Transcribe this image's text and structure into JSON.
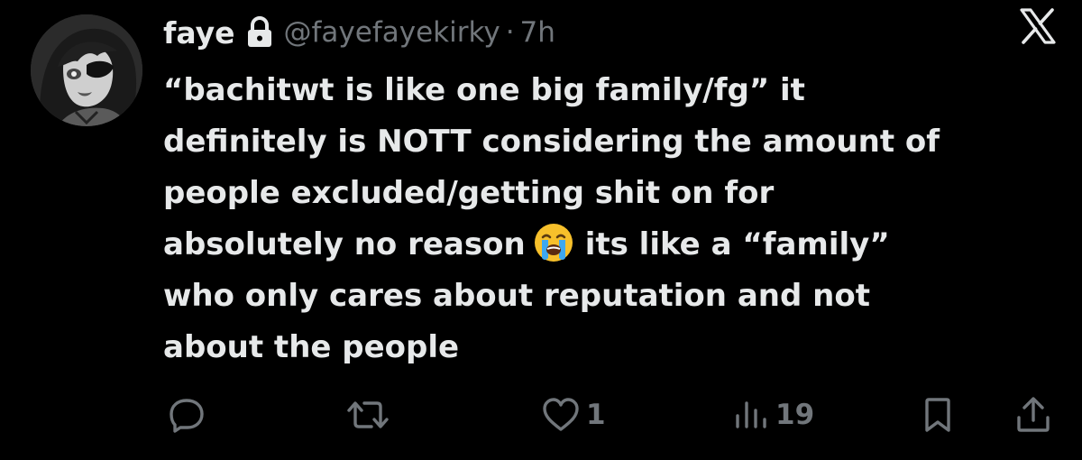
{
  "author": {
    "display_name": "faye",
    "handle": "@fayefayekirky",
    "separator": "·",
    "time": "7h",
    "lock_icon": "lock-icon"
  },
  "brand": {
    "logo_icon": "x-logo-icon"
  },
  "tweet": {
    "lines": [
      "“bachitwt is like one big family/fg” it",
      "definitely is NOTT considering the amount of",
      "people excluded/getting shit on for",
      "absolutely no reason",
      "its like a “family”",
      "who only cares about reputation and not",
      "about the people"
    ],
    "emoji": "loudly-crying-face-emoji"
  },
  "actions": {
    "reply": {
      "icon": "reply-icon"
    },
    "repost": {
      "icon": "repost-icon"
    },
    "like": {
      "icon": "heart-icon",
      "count": "1"
    },
    "views": {
      "icon": "views-bar-chart-icon",
      "count": "19"
    },
    "bookmark": {
      "icon": "bookmark-icon"
    },
    "share": {
      "icon": "share-icon"
    }
  },
  "colors": {
    "background": "#000000",
    "text_primary": "#e7e9ea",
    "text_secondary": "#71767b",
    "emoji_yellow": "#f7c02b",
    "emoji_tears": "#3ea8f0"
  }
}
